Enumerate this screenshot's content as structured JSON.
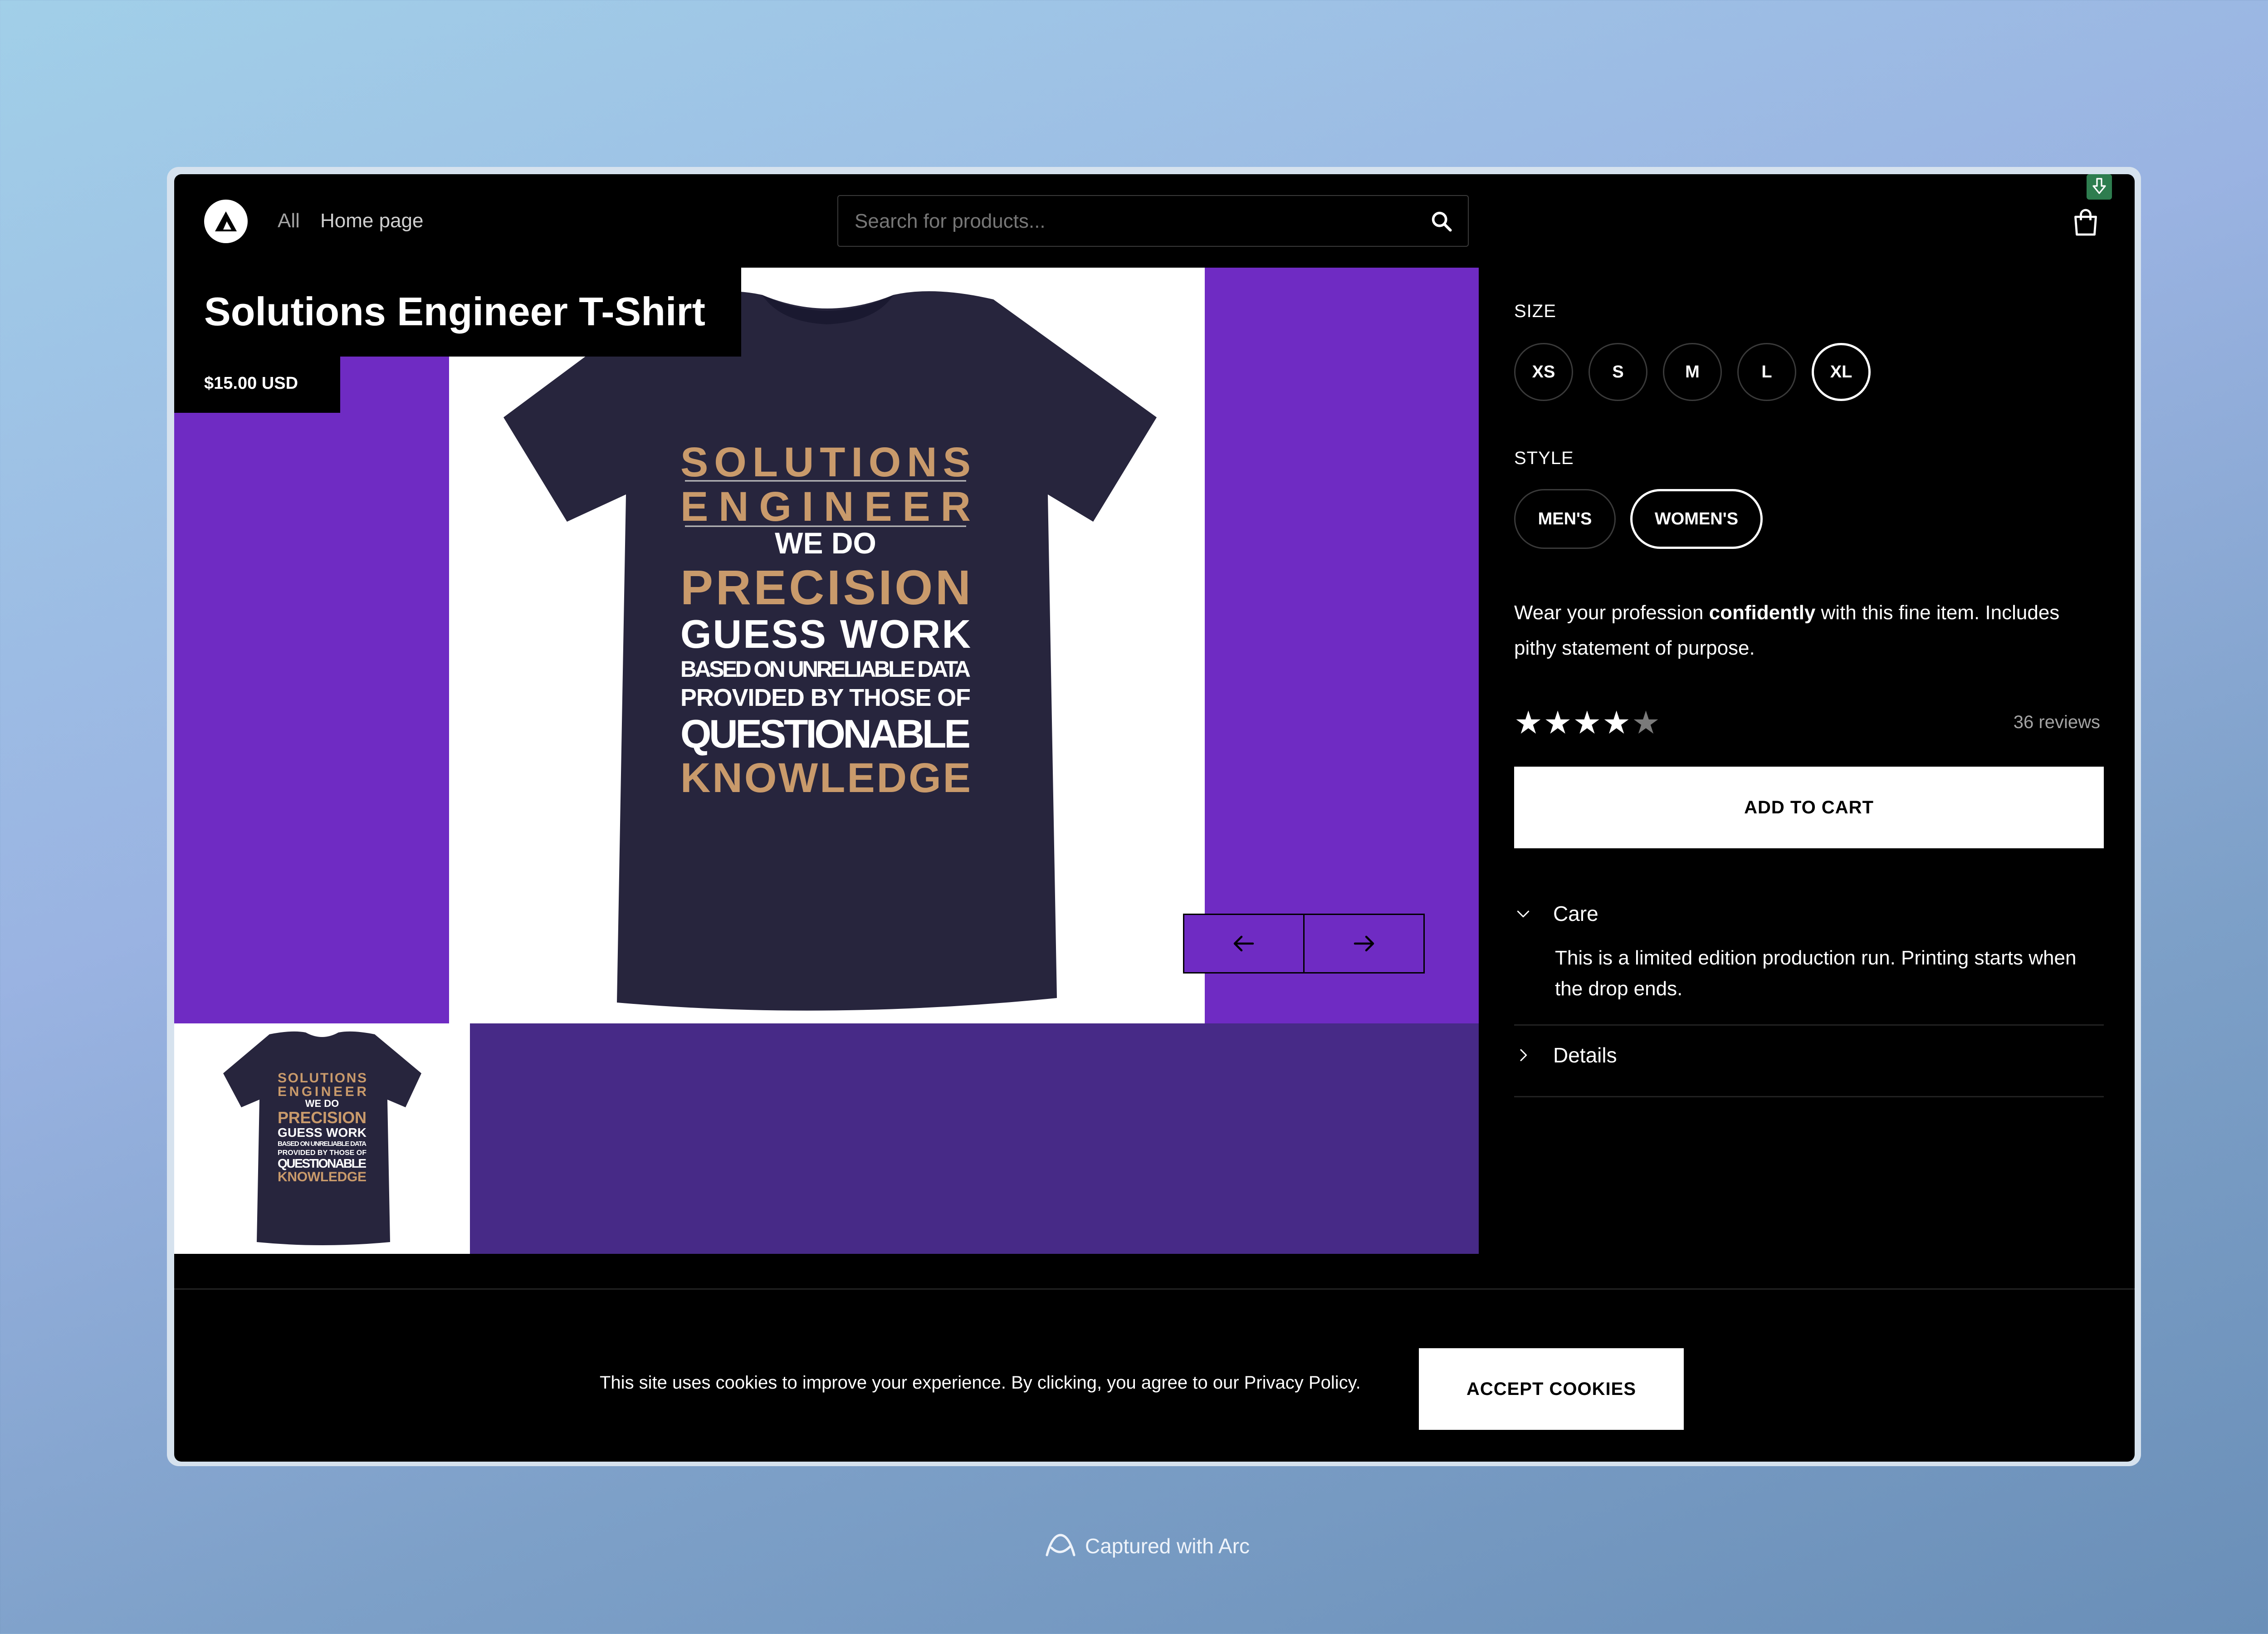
{
  "header": {
    "nav": [
      "All",
      "Home page"
    ],
    "search_placeholder": "Search for products..."
  },
  "product": {
    "title": "Solutions Engineer T-Shirt",
    "price": "$15.00 USD",
    "shirt_lines": [
      "SOLUTIONS",
      "ENGINEER",
      "WE DO",
      "PRECISION",
      "GUESS WORK",
      "BASED ON UNRELIABLE DATA",
      "PROVIDED BY THOSE OF",
      "QUESTIONABLE",
      "KNOWLEDGE"
    ],
    "description_pre": "Wear your profession ",
    "description_bold": "confidently",
    "description_post": " with this fine item. Includes pithy statement of purpose.",
    "rating": 4,
    "rating_max": 5,
    "reviews": "36 reviews"
  },
  "options": {
    "size_label": "SIZE",
    "sizes": [
      "XS",
      "S",
      "M",
      "L",
      "XL"
    ],
    "selected_size": "XL",
    "style_label": "STYLE",
    "styles": [
      "MEN'S",
      "WOMEN'S"
    ],
    "selected_style": "WOMEN'S"
  },
  "add_to_cart": "ADD TO CART",
  "accordion": {
    "care_title": "Care",
    "care_body": "This is a limited edition production run. Printing starts when the drop ends.",
    "details_title": "Details"
  },
  "cookie": {
    "text": "This site uses cookies to improve your experience. By clicking, you agree to our Privacy Policy.",
    "button": "ACCEPT COOKIES"
  },
  "footer": {
    "arc_label": "Captured with Arc"
  },
  "colors": {
    "accent_purple": "#6f2bc3",
    "thumb_strip": "#472a87",
    "shirt_navy": "#27253d",
    "print_tan": "#c99a6b"
  }
}
